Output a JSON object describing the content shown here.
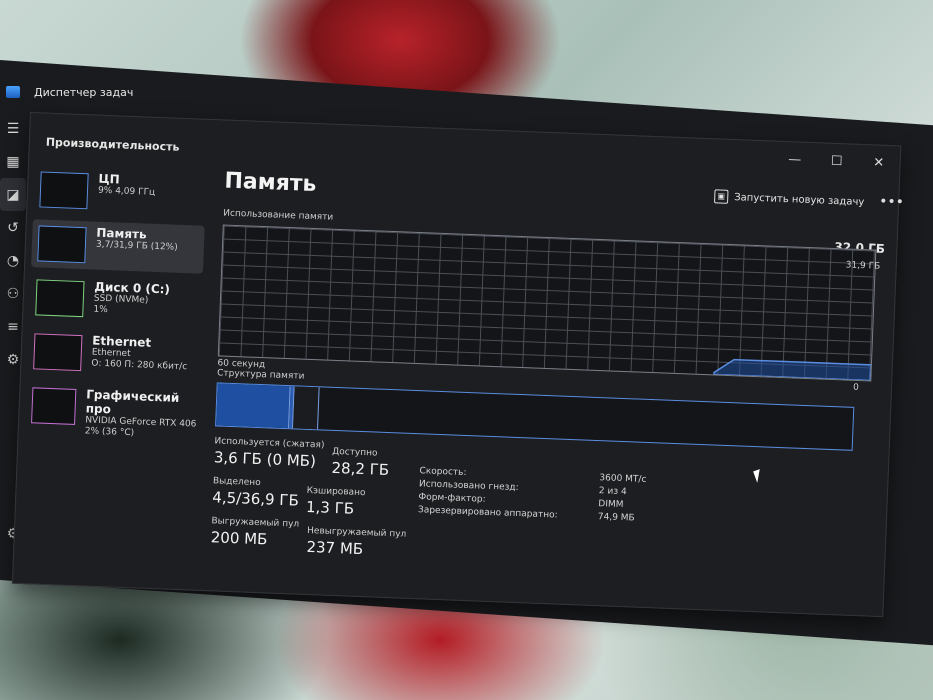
{
  "app": {
    "title": "Диспетчер задач"
  },
  "window": {
    "title": "Производительность",
    "controls": [
      "—",
      "☐",
      "✕"
    ]
  },
  "sidebar": {
    "items": [
      {
        "name": "ЦП",
        "sub1": "9% 4,09 ГГц",
        "sub2": ""
      },
      {
        "name": "Память",
        "sub1": "3,7/31,9 ГБ (12%)",
        "sub2": ""
      },
      {
        "name": "Диск 0 (C:)",
        "sub1": "SSD (NVMe)",
        "sub2": "1%"
      },
      {
        "name": "Ethernet",
        "sub1": "Ethernet",
        "sub2": "О: 160 П: 280 кбит/с"
      },
      {
        "name": "Графический про",
        "sub1": "NVIDIA GeForce RTX 406",
        "sub2": "2% (36 °C)"
      }
    ]
  },
  "main": {
    "title": "Память",
    "run_task_label": "Запустить новую задачу",
    "more_label": "•••",
    "usage_label": "Использование памяти",
    "total": "32,0 ГБ",
    "graph_max": "31,9 ГБ",
    "seconds_label": "60 секунд",
    "zero": "0",
    "structure_label": "Структура памяти"
  },
  "stats": {
    "in_use_label": "Используется (сжатая)",
    "in_use_value": "3,6 ГБ (0 МБ)",
    "available_label": "Доступно",
    "available_value": "28,2 ГБ",
    "committed_label": "Выделено",
    "committed_value": "4,5/36,9 ГБ",
    "cached_label": "Кэшировано",
    "cached_value": "1,3 ГБ",
    "paged_label": "Выгружаемый пул",
    "paged_value": "200 МБ",
    "nonpaged_label": "Невыгружаемый пул",
    "nonpaged_value": "237 МБ"
  },
  "details": [
    {
      "key": "Скорость:",
      "value": "3600 МТ/с"
    },
    {
      "key": "Использовано гнезд:",
      "value": "2 из 4"
    },
    {
      "key": "Форм-фактор:",
      "value": "DIMM"
    },
    {
      "key": "Зарезервировано аппаратно:",
      "value": "74,9 МБ"
    }
  ],
  "colors": {
    "accent": "#5a8de0",
    "memory_fill": "#1f4fa0",
    "window_bg": "#1d1e21"
  },
  "graph_usage_fraction": 0.12
}
